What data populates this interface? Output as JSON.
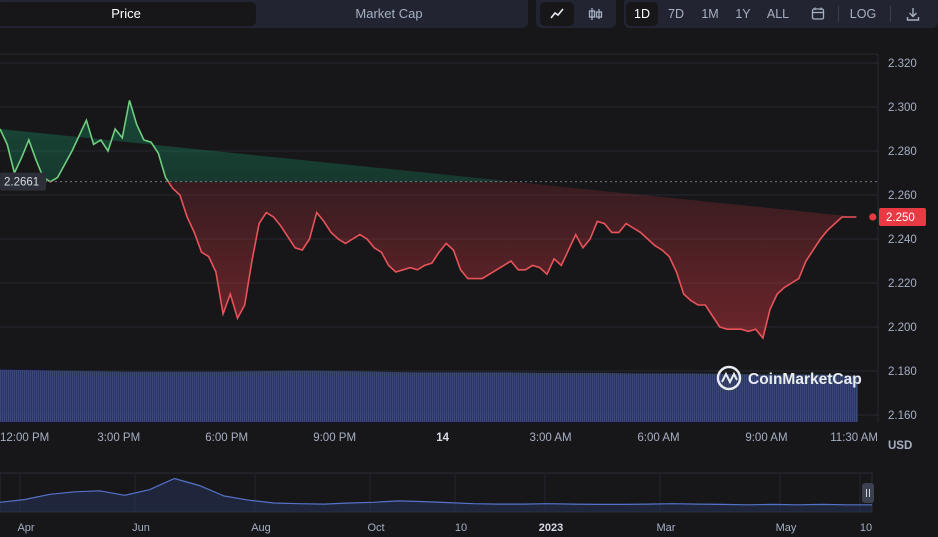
{
  "toolbar": {
    "tabs": [
      {
        "label": "Price",
        "active": true
      },
      {
        "label": "Market Cap",
        "active": false
      }
    ],
    "chart_type_icons": [
      {
        "icon": "line-chart-icon",
        "active": true
      },
      {
        "icon": "candlestick-icon",
        "active": false
      }
    ],
    "ranges": [
      {
        "label": "1D",
        "active": true
      },
      {
        "label": "7D",
        "active": false
      },
      {
        "label": "1M",
        "active": false
      },
      {
        "label": "1Y",
        "active": false
      },
      {
        "label": "ALL",
        "active": false
      }
    ],
    "calendar_icon": "calendar-icon",
    "log_label": "LOG",
    "download_icon": "download-icon"
  },
  "watermark": "CoinMarketCap",
  "currency_label": "USD",
  "colors": {
    "background": "#17171a",
    "up": "#16c784",
    "up_line": "#6fcf7e",
    "down": "#ea3943",
    "down_line": "#e8535a",
    "volume": "#3a4a78",
    "grid": "#262930",
    "navigator_line": "#5672c8"
  },
  "chart_data": {
    "type": "line",
    "reference_price": 2.2661,
    "reference_label": "2.2661",
    "current_price": 2.25,
    "current_label": "2.250",
    "ylim": [
      2.16,
      2.32
    ],
    "y_ticks": [
      "2.320",
      "2.300",
      "2.280",
      "2.260",
      "2.240",
      "2.220",
      "2.200",
      "2.180",
      "2.160"
    ],
    "x_ticks": [
      "12:00 PM",
      "3:00 PM",
      "6:00 PM",
      "9:00 PM",
      "14",
      "3:00 AM",
      "6:00 AM",
      "9:00 AM",
      "11:30 AM"
    ],
    "x_hours": [
      0,
      3,
      6,
      9,
      12,
      15,
      18,
      21,
      23.5
    ],
    "xlim_hours": [
      -0.3,
      24.1
    ],
    "series": [
      {
        "x_hours": [
          -0.3,
          -0.1,
          0.1,
          0.3,
          0.5,
          0.7,
          0.9,
          1.1,
          1.3,
          1.5,
          1.7,
          1.9,
          2.1,
          2.3,
          2.5,
          2.7,
          2.9,
          3.1,
          3.3,
          3.5,
          3.7,
          3.9,
          4.1,
          4.3,
          4.5,
          4.7,
          4.9,
          5.1,
          5.3,
          5.5,
          5.7,
          5.9,
          6.1,
          6.3,
          6.5,
          6.7,
          6.9,
          7.1,
          7.3,
          7.5,
          7.7,
          7.9,
          8.1,
          8.3,
          8.5,
          8.7,
          8.9,
          9.1,
          9.3,
          9.5,
          9.7,
          9.9,
          10.1,
          10.3,
          10.5,
          10.7,
          10.9,
          11.1,
          11.3,
          11.5,
          11.7,
          11.9,
          12.1,
          12.3,
          12.5,
          12.7,
          12.9,
          13.1,
          13.3,
          13.5,
          13.7,
          13.9,
          14.1,
          14.3,
          14.5,
          14.7,
          14.9,
          15.1,
          15.3,
          15.5,
          15.7,
          15.9,
          16.1,
          16.3,
          16.5,
          16.7,
          16.9,
          17.1,
          17.3,
          17.5,
          17.7,
          17.9,
          18.1,
          18.3,
          18.5,
          18.7,
          18.9,
          19.1,
          19.3,
          19.5,
          19.7,
          19.9,
          20.1,
          20.3,
          20.5,
          20.7,
          20.9,
          21.1,
          21.3,
          21.5,
          21.7,
          21.9,
          22.1,
          22.3,
          22.5,
          22.7,
          22.9,
          23.1,
          23.3,
          23.5,
          23.7,
          23.9
        ],
        "values": [
          2.29,
          2.283,
          2.27,
          2.277,
          2.285,
          2.276,
          2.268,
          2.266,
          2.268,
          2.274,
          2.28,
          2.287,
          2.294,
          2.283,
          2.285,
          2.28,
          2.29,
          2.286,
          2.303,
          2.292,
          2.285,
          2.284,
          2.279,
          2.268,
          2.263,
          2.26,
          2.25,
          2.243,
          2.234,
          2.232,
          2.225,
          2.206,
          2.215,
          2.204,
          2.21,
          2.23,
          2.247,
          2.252,
          2.25,
          2.246,
          2.241,
          2.236,
          2.235,
          2.24,
          2.252,
          2.248,
          2.243,
          2.24,
          2.238,
          2.24,
          2.242,
          2.24,
          2.236,
          2.234,
          2.228,
          2.225,
          2.226,
          2.227,
          2.226,
          2.228,
          2.229,
          2.234,
          2.238,
          2.235,
          2.226,
          2.222,
          2.222,
          2.222,
          2.224,
          2.226,
          2.228,
          2.23,
          2.226,
          2.226,
          2.228,
          2.227,
          2.224,
          2.231,
          2.228,
          2.235,
          2.242,
          2.236,
          2.24,
          2.248,
          2.247,
          2.243,
          2.243,
          2.247,
          2.245,
          2.243,
          2.24,
          2.237,
          2.235,
          2.232,
          2.225,
          2.215,
          2.212,
          2.21,
          2.21,
          2.205,
          2.2,
          2.199,
          2.199,
          2.199,
          2.198,
          2.199,
          2.195,
          2.208,
          2.215,
          2.218,
          2.22,
          2.222,
          2.23,
          2.235,
          2.24,
          2.244,
          2.247,
          2.25,
          2.25,
          2.25
        ]
      }
    ],
    "volume_series": {
      "x_hours": [
        -0.3,
        0.6,
        1.5,
        2.4,
        3.3,
        4.2,
        5.1,
        6,
        6.9,
        7.8,
        8.7,
        9.6,
        10.5,
        11.4,
        12.3,
        13.2,
        14.1,
        15,
        15.9,
        16.8,
        17.7,
        18.6,
        19.5,
        20.4,
        21.3,
        22.2,
        23.1,
        23.8
      ],
      "values": [
        0.97,
        0.96,
        0.95,
        0.94,
        0.93,
        0.93,
        0.93,
        0.93,
        0.94,
        0.95,
        0.95,
        0.94,
        0.93,
        0.92,
        0.92,
        0.92,
        0.92,
        0.91,
        0.91,
        0.91,
        0.9,
        0.9,
        0.9,
        0.89,
        0.88,
        0.88,
        0.88,
        0.86
      ]
    },
    "navigator": {
      "x_ticks": [
        "Apr",
        "Jun",
        "Aug",
        "Oct",
        "10",
        "2023",
        "Mar",
        "May",
        "10"
      ],
      "values": [
        0.22,
        0.3,
        0.45,
        0.52,
        0.55,
        0.42,
        0.58,
        0.9,
        0.7,
        0.4,
        0.28,
        0.2,
        0.18,
        0.17,
        0.2,
        0.22,
        0.26,
        0.24,
        0.21,
        0.18,
        0.17,
        0.17,
        0.18,
        0.17,
        0.16,
        0.16,
        0.17,
        0.18,
        0.17,
        0.16,
        0.15,
        0.16,
        0.15,
        0.16,
        0.15,
        0.15
      ]
    }
  }
}
